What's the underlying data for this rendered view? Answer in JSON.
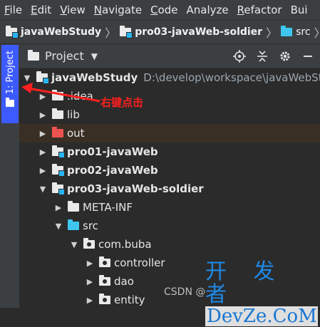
{
  "menubar": {
    "items": [
      {
        "mn": "F",
        "rest": "ile"
      },
      {
        "mn": "E",
        "rest": "dit"
      },
      {
        "mn": "V",
        "rest": "iew"
      },
      {
        "mn": "N",
        "rest": "avigate"
      },
      {
        "mn": "C",
        "rest": "ode"
      },
      {
        "mn": "",
        "rest": "Analyze"
      },
      {
        "mn": "R",
        "rest": "efactor"
      },
      {
        "mn": "",
        "rest": "Bui"
      }
    ]
  },
  "breadcrumb": {
    "items": [
      "javaWebStudy",
      "pro03-javaWeb-soldier",
      "src"
    ]
  },
  "sidebar": {
    "tab_label": "1: Project"
  },
  "panel": {
    "title": "Project",
    "dropdown_glyph": "▼"
  },
  "tree": {
    "root": {
      "label": "javaWebStudy",
      "path": "D:\\develop\\workspace\\javaWebStu"
    },
    "rows": [
      {
        "label": ".idea"
      },
      {
        "label": "lib"
      },
      {
        "label": "out"
      },
      {
        "label": "pro01-javaWeb"
      },
      {
        "label": "pro02-javaWeb"
      },
      {
        "label": "pro03-javaWeb-soldier"
      },
      {
        "label": "META-INF"
      },
      {
        "label": "src"
      },
      {
        "label": "com.buba"
      },
      {
        "label": "controller"
      },
      {
        "label": "dao"
      },
      {
        "label": "entity"
      }
    ]
  },
  "annotation": {
    "text": "右键点击",
    "color": "#ff1f1f"
  },
  "watermark": {
    "csdn": "CSDN @",
    "top": "开 发 者",
    "bottom": "DevZe.CoM"
  },
  "colors": {
    "accent_tab": "#3d5afe",
    "folder_blue": "#3ec6f0",
    "folder_red": "#ef5350",
    "selected_row": "#3a2f25"
  }
}
